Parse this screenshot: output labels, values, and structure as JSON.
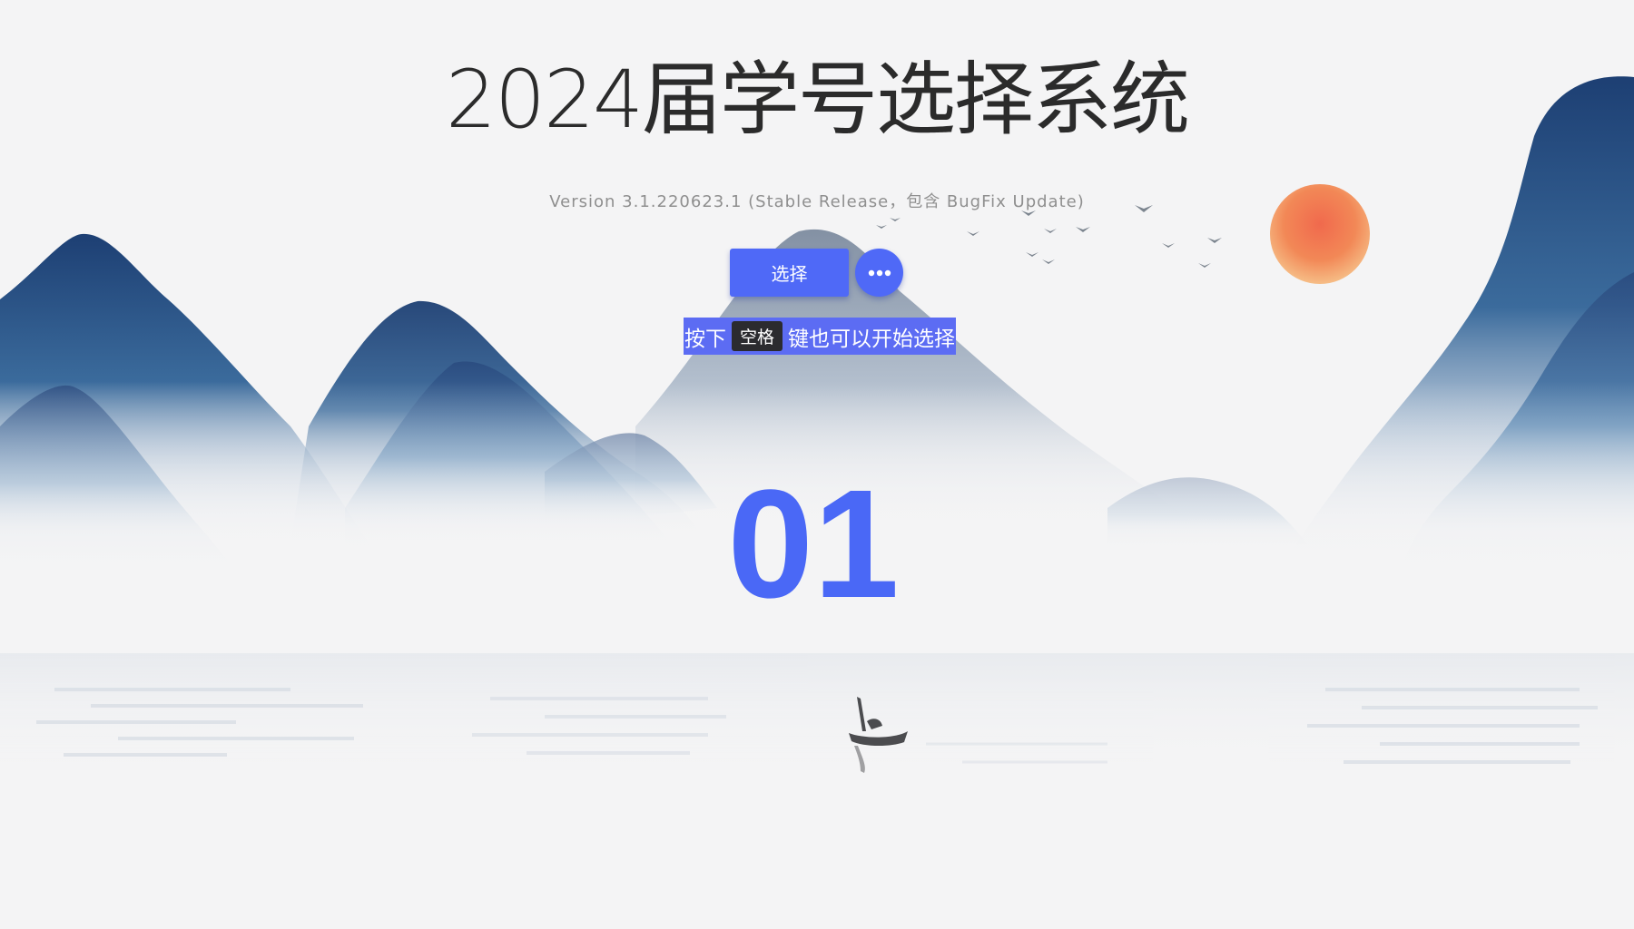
{
  "app": {
    "title": "2024届学号选择系统",
    "version": "Version 3.1.220623.1 (Stable Release，包含 BugFix Update)"
  },
  "controls": {
    "choose_label": "选择",
    "more_icon": "more-horizontal-icon"
  },
  "hint": {
    "prefix": "按下",
    "key": "空格",
    "suffix": "键也可以开始选择"
  },
  "result": {
    "number": "01"
  },
  "colors": {
    "accent": "#4f69f7",
    "number": "#4a68f6",
    "hint_bg": "#5c6cf3",
    "sun": "#ee5a3c"
  }
}
